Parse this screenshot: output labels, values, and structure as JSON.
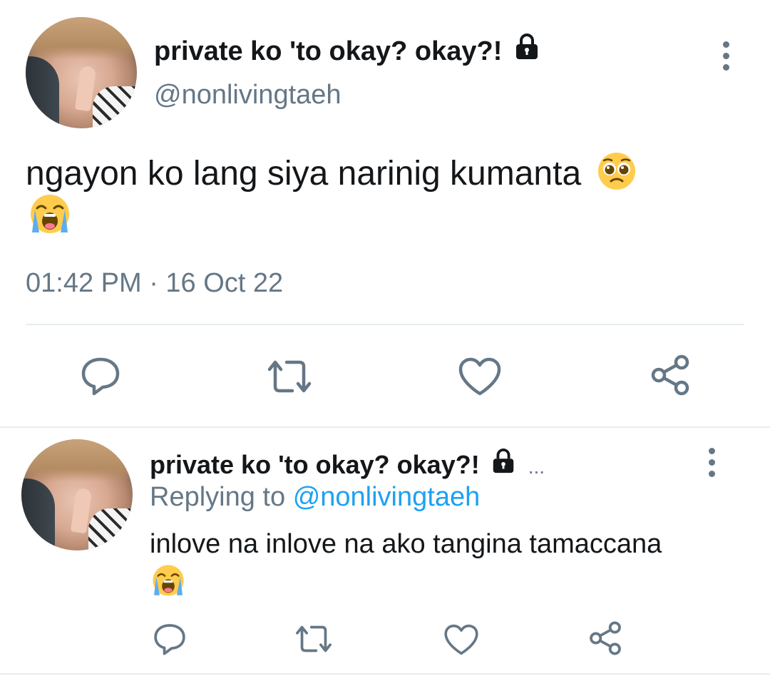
{
  "tweet": {
    "display_name": "private ko 'to okay? okay?!",
    "handle": "@nonlivingtaeh",
    "text": "ngayon ko lang siya narinig kumanta",
    "timestamp": "01:42 PM · 16 Oct 22",
    "icons": [
      "lock-icon",
      "more-icon",
      "pleading-face-emoji",
      "loudly-crying-face-emoji",
      "reply-icon",
      "retweet-icon",
      "like-icon",
      "share-icon"
    ]
  },
  "reply": {
    "display_name": "private ko 'to okay? okay?!",
    "ellipsis": "...",
    "replying_prefix": "Replying to",
    "replying_handle": "@nonlivingtaeh",
    "text": "inlove na inlove na ako tangina tamaccana",
    "icons": [
      "lock-icon",
      "more-icon",
      "loudly-crying-face-emoji",
      "reply-icon",
      "retweet-icon",
      "like-icon",
      "share-icon"
    ]
  },
  "colors": {
    "text": "#14171a",
    "secondary": "#657786",
    "link": "#1da1f2",
    "divider": "#e6ecf0",
    "icon": "#657786"
  }
}
